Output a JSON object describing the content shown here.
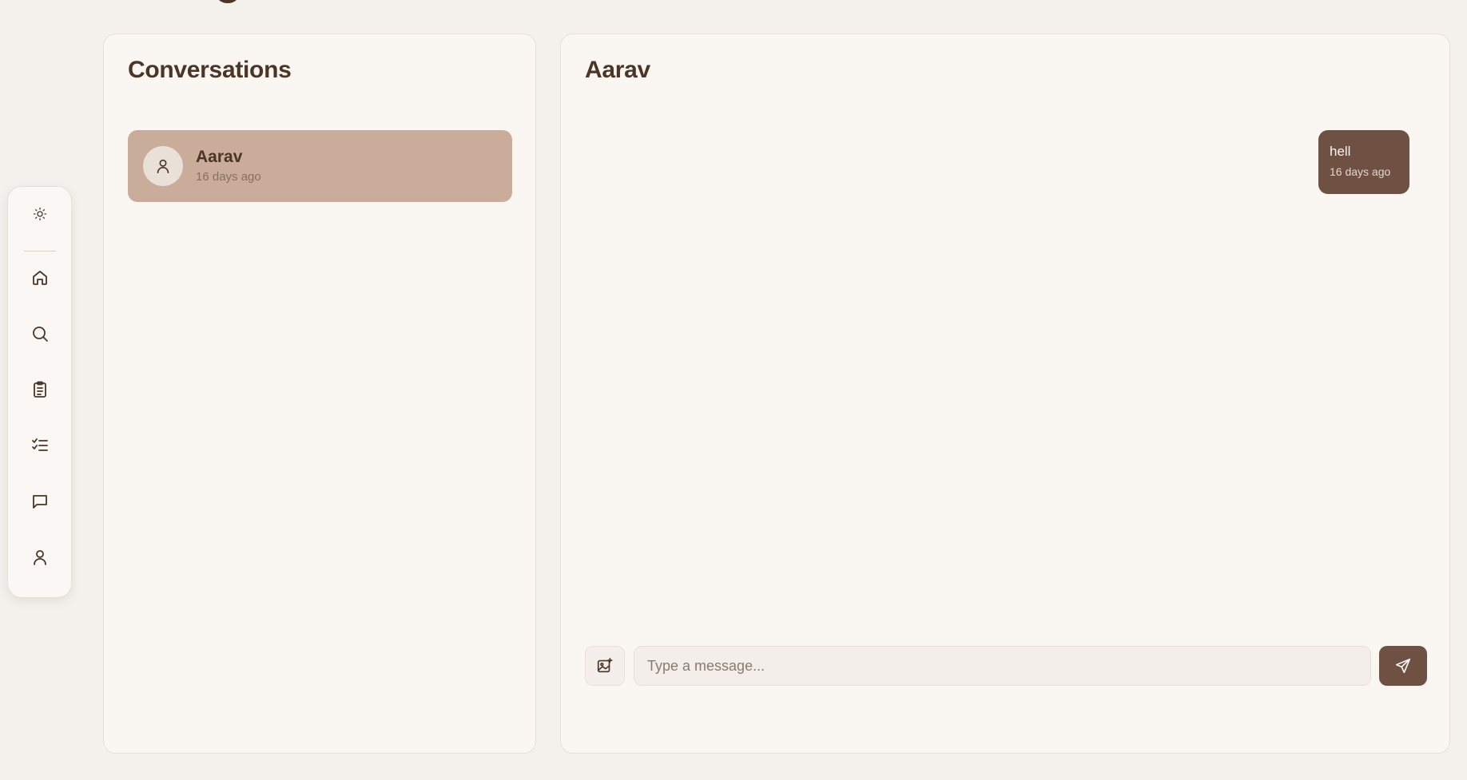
{
  "sidebar": {
    "items": [
      {
        "icon": "sun-icon",
        "label": "Toggle theme"
      },
      {
        "icon": "home-icon",
        "label": "Home"
      },
      {
        "icon": "search-icon",
        "label": "Search"
      },
      {
        "icon": "clipboard-icon",
        "label": "Clipboard"
      },
      {
        "icon": "checklist-icon",
        "label": "Tasks"
      },
      {
        "icon": "message-icon",
        "label": "Messages"
      },
      {
        "icon": "user-icon",
        "label": "Profile"
      }
    ]
  },
  "conversations": {
    "title": "Conversations",
    "items": [
      {
        "name": "Aarav",
        "time": "16 days ago",
        "selected": true,
        "avatar_icon": "user-icon"
      }
    ]
  },
  "chat": {
    "title": "Aarav",
    "messages": [
      {
        "text": "hell",
        "time": "16 days ago",
        "outgoing": true
      }
    ],
    "composer": {
      "placeholder": "Type a message...",
      "value": "",
      "attach_icon": "image-plus-icon",
      "send_icon": "send-icon"
    }
  },
  "colors": {
    "background": "#f4f1ed",
    "panel": "#faf6f2",
    "selected_conversation": "#c9ac9a",
    "accent": "#6e5142",
    "text": "#4a3526"
  }
}
